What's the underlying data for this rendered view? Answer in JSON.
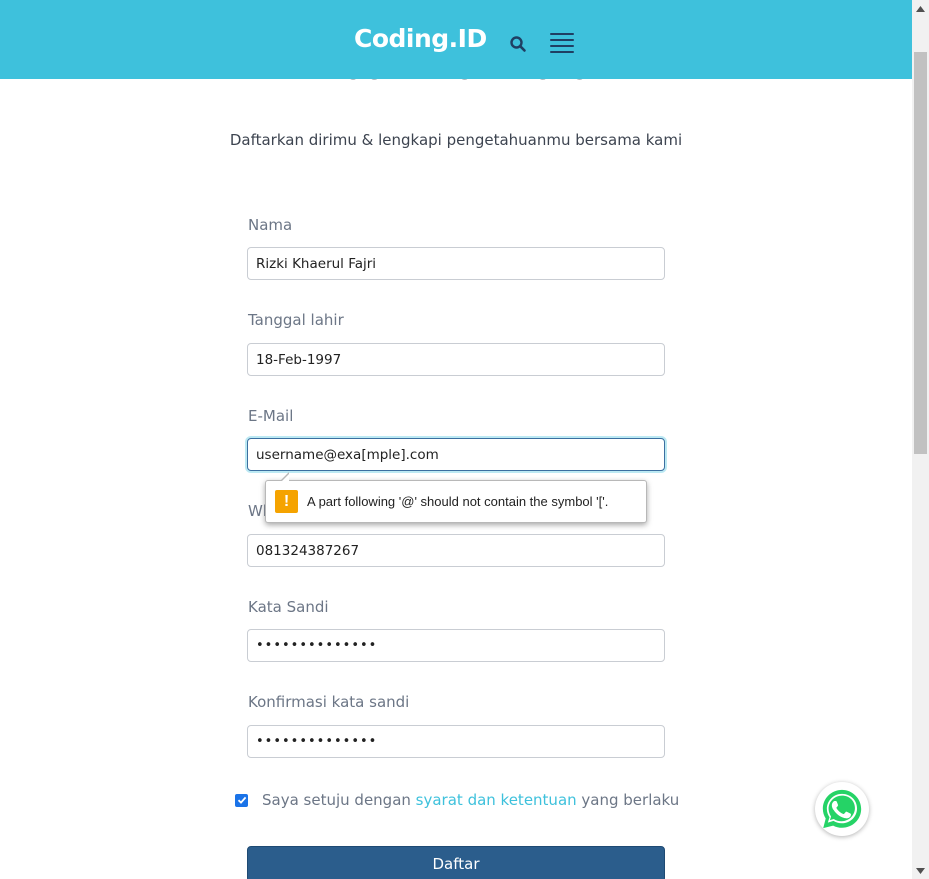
{
  "header": {
    "logo": "Coding.ID",
    "search_icon": "search-icon",
    "menu_icon": "hamburger-menu-icon",
    "background": "#3ec1dc"
  },
  "page": {
    "heading": "Buat Akun Baru",
    "subtitle": "Daftarkan dirimu & lengkapi pengetahuanmu bersama kami"
  },
  "form": {
    "name": {
      "label": "Nama",
      "value": "Rizki Khaerul Fajri"
    },
    "birthdate": {
      "label": "Tanggal lahir",
      "value": "18-Feb-1997"
    },
    "email": {
      "label": "E-Mail",
      "value": "username@exa[mple].com"
    },
    "whatsapp": {
      "label": "Whatsapp",
      "value": "081324387267"
    },
    "password": {
      "label": "Kata Sandi",
      "value": "••••••••••••••"
    },
    "password_confirm": {
      "label": "Konfirmasi kata sandi",
      "value": "••••••••••••••"
    },
    "agree": {
      "checked": true,
      "text_before": "Saya setuju dengan ",
      "link": "syarat dan ketentuan",
      "text_after": " yang berlaku"
    },
    "submit_label": "Daftar"
  },
  "validation_tooltip": {
    "icon": "warning-icon",
    "icon_glyph": "!",
    "message": "A part following '@' should not contain the symbol '['."
  },
  "floating": {
    "whatsapp_icon": "whatsapp-icon",
    "color": "#25d366"
  },
  "colors": {
    "accent": "#3ec1dc",
    "button": "#2b5d8c",
    "label": "#6c7686"
  }
}
